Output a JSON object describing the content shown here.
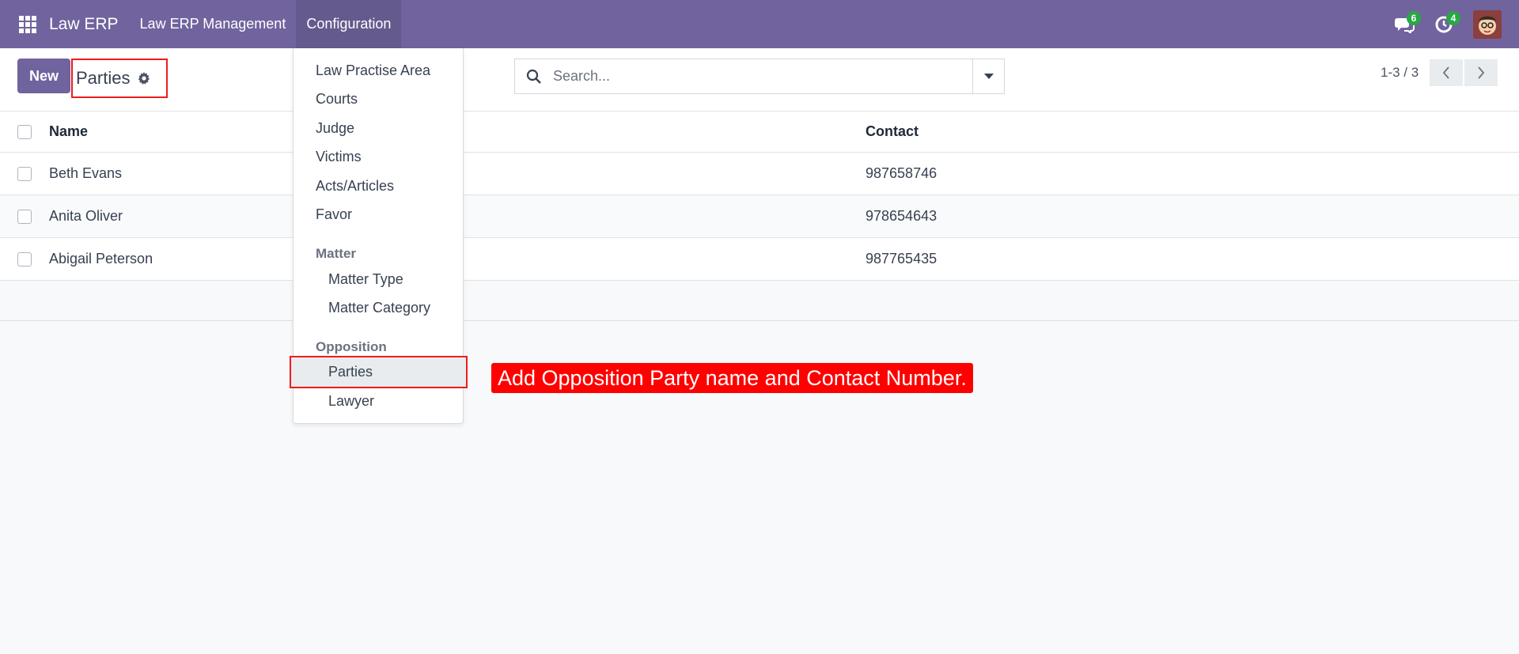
{
  "navbar": {
    "brand": "Law ERP",
    "menus": [
      "Law ERP Management",
      "Configuration"
    ],
    "messages_count": "6",
    "activities_count": "4",
    "bg_color": "#71639e"
  },
  "control_panel": {
    "new_label": "New",
    "breadcrumb_title": "Parties",
    "search_placeholder": "Search...",
    "pager": "1-3 / 3"
  },
  "list": {
    "columns": [
      "Name",
      "Contact"
    ],
    "rows": [
      {
        "name": "Beth Evans",
        "contact": "987658746"
      },
      {
        "name": "Anita Oliver",
        "contact": "978654643"
      },
      {
        "name": "Abigail Peterson",
        "contact": "987765435"
      }
    ]
  },
  "dropdown": {
    "items": [
      "Law Practise Area",
      "Courts",
      "Judge",
      "Victims",
      "Acts/Articles",
      "Favor"
    ],
    "matter_section": "Matter",
    "matter_items": [
      "Matter Type",
      "Matter Category"
    ],
    "opposition_section": "Opposition",
    "opposition_items": [
      "Parties",
      "Lawyer"
    ]
  },
  "annotation": "Add Opposition Party name and Contact Number.",
  "colors": {
    "highlight": "#ee1c1c",
    "accent": "#71639e",
    "badge": "#28a745"
  }
}
